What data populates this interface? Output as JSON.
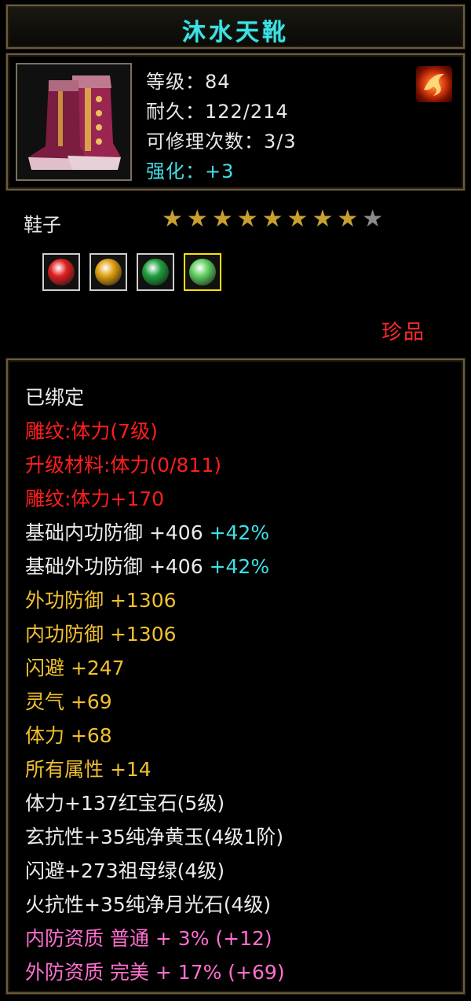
{
  "item": {
    "name": "沐水天靴",
    "level_line": "等级：84",
    "durability_line": "耐久：122/214",
    "repair_line": "可修理次数：3/3",
    "enhance_line": "强化：+3",
    "type": "鞋子",
    "stars": {
      "filled": 8,
      "total": 9
    },
    "rarity": "珍品"
  },
  "gems": [
    {
      "name": "ruby-icon",
      "color": "#e02020"
    },
    {
      "name": "yellow-jade-icon",
      "color": "#e0a010"
    },
    {
      "name": "emerald-icon",
      "color": "#20a040"
    },
    {
      "name": "moonstone-icon",
      "color": "#60d060"
    }
  ],
  "attributes": {
    "bound": "已绑定",
    "carve_level": "雕纹:体力(7级)",
    "upgrade_material": "升级材料:体力(0/811)",
    "carve_bonus": "雕纹:体力+170",
    "base_inner_def": "基础内功防御 +406",
    "base_inner_def_pct": " +42%",
    "base_outer_def": "基础外功防御 +406",
    "base_outer_def_pct": " +42%",
    "outer_def": "外功防御 +1306",
    "inner_def": "内功防御 +1306",
    "dodge": "闪避 +247",
    "spirit": "灵气 +69",
    "stamina": "体力 +68",
    "all_attr": "所有属性 +14",
    "gem1": "体力+137红宝石(5级)",
    "gem2": "玄抗性+35纯净黄玉(4级1阶)",
    "gem3": "闪避+273祖母绿(4级)",
    "gem4": "火抗性+35纯净月光石(4级)",
    "quality_inner": "内防资质 普通 + 3% (+12)",
    "quality_outer": "外防资质 完美 + 17% (+69)"
  }
}
